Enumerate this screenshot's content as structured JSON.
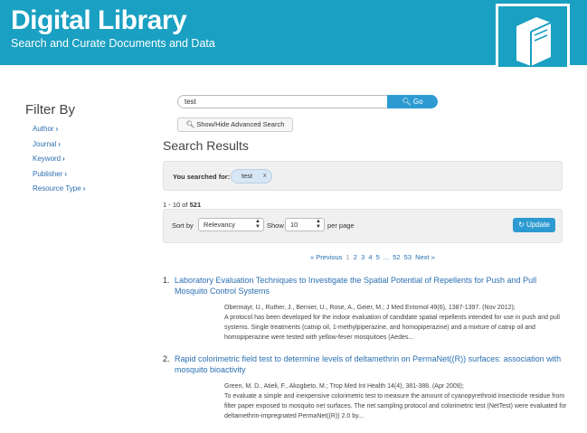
{
  "header": {
    "title": "Digital Library",
    "subtitle": "Search and Curate Documents and Data",
    "accent_color": "#1aa0c2",
    "logo_icon": "book-icon"
  },
  "sidebar": {
    "title": "Filter By",
    "items": [
      {
        "label": "Author"
      },
      {
        "label": "Journal"
      },
      {
        "label": "Keyword"
      },
      {
        "label": "Publisher"
      },
      {
        "label": "Resource Type"
      }
    ]
  },
  "search": {
    "value": "test",
    "go_label": "Go",
    "advanced_label": "Show/Hide Advanced Search"
  },
  "results": {
    "heading": "Search Results",
    "searched_for_label": "You searched for:",
    "term": "test",
    "remove_label": "x",
    "count_text": "1 - 10 of ",
    "total": "521",
    "sort_by_label": "Sort by",
    "sort_value": "Relevancy",
    "show_label": "Show",
    "show_value": "10",
    "per_page_label": "per page",
    "update_label": "Update",
    "pagination": [
      "« Previous",
      "1",
      "2",
      "3",
      "4",
      "5",
      "...",
      "52",
      "53",
      "Next »"
    ],
    "items": [
      {
        "number": "1.",
        "title": "Laboratory Evaluation Techniques to Investigate the Spatial Potential of Repellents for Push and Pull Mosquito Control Systems",
        "citation": "Obermayr, U., Ruther, J., Bernier, U., Rose, A., Geier, M.; J Med Entomol 49(6), 1387-1397. (Nov 2012);",
        "abstract": "A protocol has been developed for the indoor evaluation of candidate spatial repellents intended for use in push and pull systems. Single treatments (catnip oil, 1-methylpiperazine, and homopiperazine) and a mixture of catnip oil and homopiperazine were tested with yellow-fever mosquitoes (Aedes..."
      },
      {
        "number": "2.",
        "title": "Rapid colorimetric field test to determine levels of deltamethrin on PermaNet((R)) surfaces: association with mosquito bioactivity",
        "citation": "Green, M. D., Atieli, F., Akogbeto, M.; Trop Med Int Health 14(4), 381-388. (Apr 2009);",
        "abstract": "To evaluate a simple and inexpensive colorimetric test to measure the amount of cyanopyrethroid insecticide residue from filter paper exposed to mosquito net surfaces. The net sampling protocol and colorimetric test (NetTest) were evaluated for deltamethrin-impregnated PermaNet((R)) 2.0 by..."
      }
    ]
  }
}
